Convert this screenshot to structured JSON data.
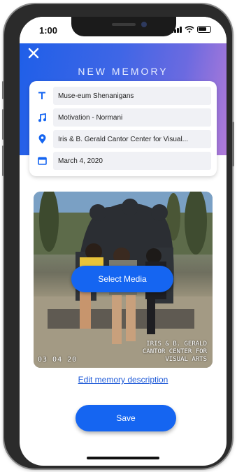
{
  "status_bar": {
    "time": "1:00",
    "icons": [
      "signal-icon",
      "wifi-icon",
      "battery-icon"
    ]
  },
  "header": {
    "title": "NEW MEMORY",
    "close_icon": "close-icon"
  },
  "form": {
    "title": {
      "icon": "text-icon",
      "value": "Muse-eum Shenanigans"
    },
    "song": {
      "icon": "music-note-icon",
      "value": "Motivation - Normani"
    },
    "location": {
      "icon": "location-pin-icon",
      "value": "Iris & B. Gerald Cantor Center for Visual..."
    },
    "date": {
      "icon": "calendar-icon",
      "value": "March 4, 2020"
    }
  },
  "media": {
    "select_label": "Select Media",
    "photo_date": "03 04 20",
    "photo_caption": "IRIS & B. GERALD CANTOR CENTER FOR VISUAL ARTS"
  },
  "edit_description_label": "Edit memory description",
  "save_label": "Save",
  "colors": {
    "accent": "#1565f1",
    "header_gradient_start": "#1f5fe8",
    "header_gradient_end": "#b07ad8",
    "link": "#1e5ad8"
  }
}
